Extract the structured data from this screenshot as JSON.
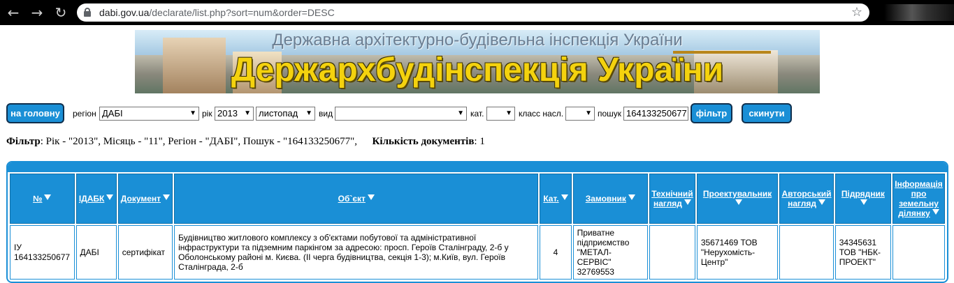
{
  "browser": {
    "url_host": "dabi.gov.ua",
    "url_path": "/declarate/list.php?sort=num&order=DESC"
  },
  "banner": {
    "subtitle": "Державна архітектурно-будівельна інспекція України",
    "title": "Держархбудінспекція України"
  },
  "toolbar": {
    "home_label": "на головну",
    "region_label": "регіон",
    "region_value": "ДАБІ",
    "year_label": "рік",
    "year_value": "2013",
    "month_value": "листопад",
    "type_label": "вид",
    "type_value": "",
    "cat_label": "кат.",
    "cat_value": "",
    "class_label": "класс насл.",
    "class_value": "",
    "search_label": "пошук",
    "search_value": "164133250677",
    "filter_label": "фільтр",
    "reset_label": "скинути"
  },
  "filter_summary": {
    "filter_label": "Фільтр",
    "filter_text": ": Рік - \"2013\", Місяць - \"11\", Регіон - \"ДАБІ\", Пошук - \"164133250677\",",
    "count_label": "Кількість документів",
    "count_text": ": 1"
  },
  "table": {
    "headers": {
      "num": "№",
      "idabk": "ІДАБК",
      "doc": "Документ",
      "object": "Об`єкт",
      "cat": "Кат.",
      "customer_h": "Замовник",
      "tech_1": "Технічний",
      "tech_2": "нагляд",
      "designer": "Проектувальник",
      "author_1": "Авторський",
      "author_2": "нагляд",
      "contractor": "Підрядник",
      "land_1": "Інформація",
      "land_2": "про",
      "land_3": "земельну",
      "land_4": "ділянку"
    },
    "row": {
      "num_1": "ІУ",
      "num_2": "164133250677",
      "idabk": "ДАБІ",
      "doc": "сертифікат",
      "object": "Будівництво житлового комплексу з об'єктами побутової та адміністративної інфраструктури та підземним паркінгом за адресою: просп. Героїв Сталінграду, 2-б у Оболонському районі м. Києва. (ІІ черга будівництва, секція 1-3); м.Київ, вул. Героїв Сталінграда, 2-б",
      "cat": "4",
      "customer_1": "Приватне підприємство",
      "customer_2": "\"МЕТАЛ-СЕРВІС\"",
      "customer_3": "32769553",
      "tech": "",
      "designer_1": "35671469 ТОВ",
      "designer_2": "\"Нерухомість-",
      "designer_3": "Центр\"",
      "author": "",
      "contractor_1": "34345631",
      "contractor_2": "ТОВ \"НБК-",
      "contractor_3": "ПРОЕКТ\"",
      "land": ""
    }
  }
}
